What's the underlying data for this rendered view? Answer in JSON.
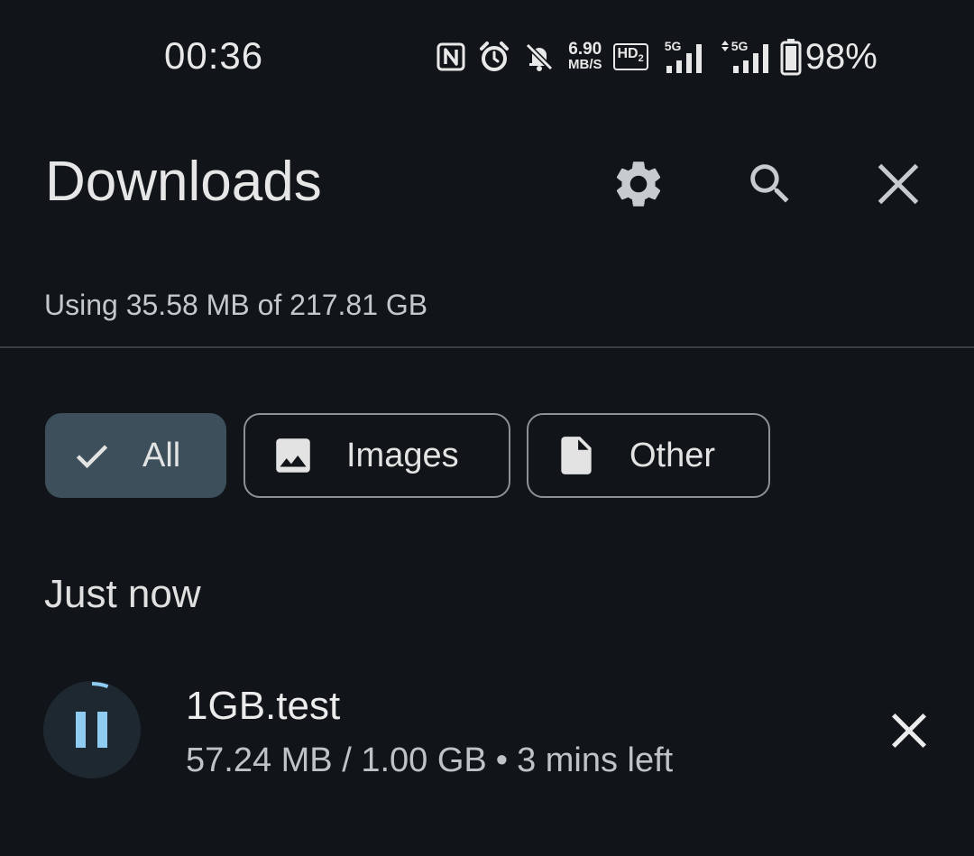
{
  "status_bar": {
    "time": "00:36",
    "icons": [
      "nfc-icon",
      "alarm-icon",
      "bell-off-icon",
      "hd-voice-icon",
      "signal-5g-icon",
      "signal-5g-data-icon",
      "battery-icon"
    ],
    "speed_value": "6.90",
    "speed_unit": "MB/S",
    "hd_label": "HD",
    "hd_sub": "2",
    "net1_label": "5G",
    "net2_label": "5G",
    "battery_percent": "98%"
  },
  "header": {
    "title": "Downloads",
    "actions": [
      "settings-icon",
      "search-icon",
      "close-icon"
    ]
  },
  "storage": {
    "text": "Using 35.58 MB of 217.81 GB"
  },
  "filters": {
    "chips": [
      {
        "label": "All",
        "icon": "check-icon",
        "selected": true
      },
      {
        "label": "Images",
        "icon": "image-icon",
        "selected": false
      },
      {
        "label": "Other",
        "icon": "file-icon",
        "selected": false
      }
    ]
  },
  "sections": [
    {
      "header": "Just now",
      "items": [
        {
          "title": "1GB.test",
          "downloaded": "57.24 MB / 1.00 GB",
          "separator": "•",
          "time_left": "3 mins left",
          "progress": 0.056,
          "state_icon": "pause-icon"
        }
      ]
    }
  ],
  "colors": {
    "background": "#111418",
    "chip_selected": "#3d4f5b",
    "progress_accent": "#8ecdf1",
    "text_primary": "#e3e3e3",
    "text_secondary": "#bfc3c7"
  }
}
